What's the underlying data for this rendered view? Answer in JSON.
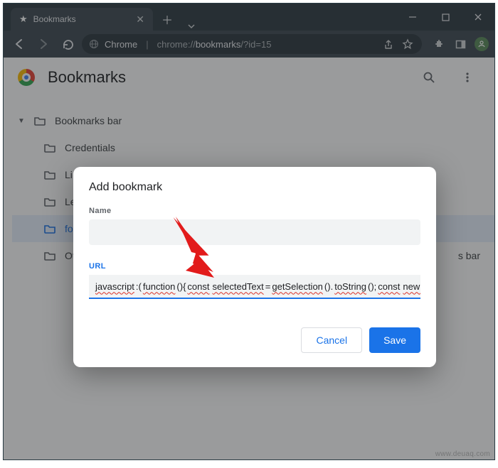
{
  "titlebar": {
    "tab_label": "Bookmarks"
  },
  "addressbar": {
    "chrome_label": "Chrome",
    "url_scheme": "chrome://",
    "url_host": "bookmarks",
    "url_path": "/?id=15"
  },
  "page": {
    "title": "Bookmarks"
  },
  "tree": {
    "root": "Bookmarks bar",
    "items": [
      {
        "label": "Credentials"
      },
      {
        "label": "Li"
      },
      {
        "label": "Le"
      },
      {
        "label": "fo",
        "selected": true
      },
      {
        "label": "Othe",
        "suffix": "s bar"
      }
    ]
  },
  "dialog": {
    "title": "Add bookmark",
    "name_label": "Name",
    "url_label": "URL",
    "url_value_words": [
      "javascript",
      ":(",
      "function",
      "(){",
      "const",
      " ",
      "selectedText",
      "=",
      "getSelection",
      "().",
      "toString",
      "();",
      "const",
      " ",
      "newUrl"
    ],
    "cancel": "Cancel",
    "save": "Save"
  },
  "watermark": "www.deuaq.com"
}
